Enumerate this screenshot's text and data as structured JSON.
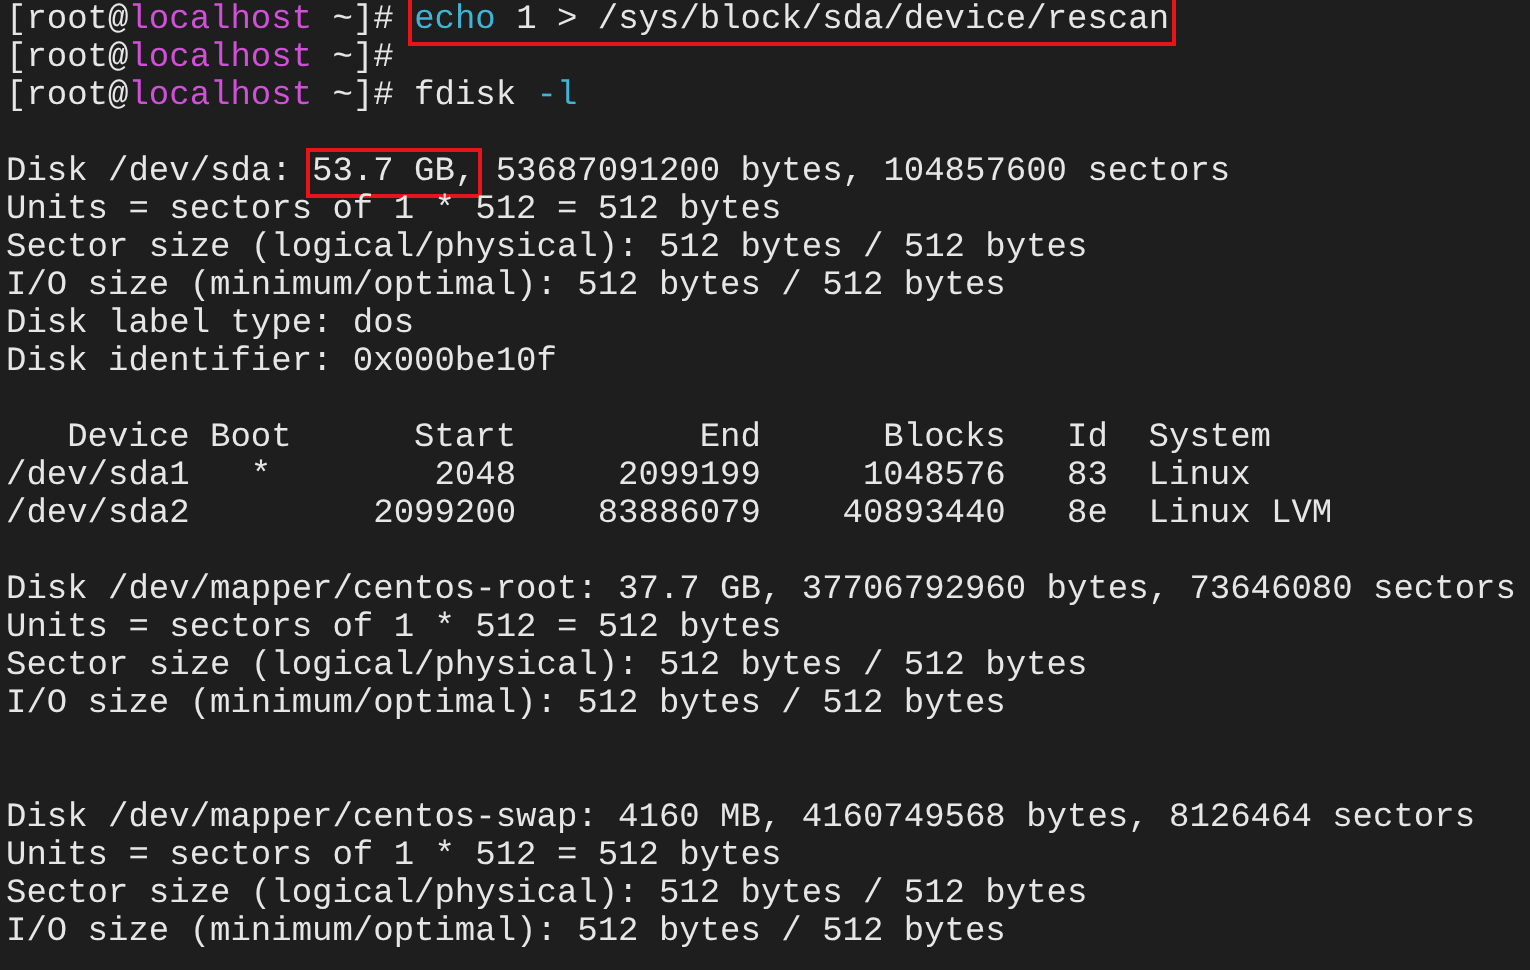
{
  "terminal": {
    "lines": [
      {
        "kind": "text",
        "segments": [
          {
            "text": "[root@",
            "kind": "plain",
            "boxed": false
          },
          {
            "text": "localhost",
            "kind": "host",
            "boxed": false
          },
          {
            "text": " ~]# ",
            "kind": "plain",
            "boxed": false
          },
          {
            "text": "echo",
            "kind": "keyword",
            "boxed": true
          },
          {
            "text": " 1 > /sys/block/sda/device/rescan",
            "kind": "plain",
            "boxed": true
          }
        ]
      },
      {
        "kind": "text",
        "segments": [
          {
            "text": "[root@",
            "kind": "plain",
            "boxed": false
          },
          {
            "text": "localhost",
            "kind": "host",
            "boxed": false
          },
          {
            "text": " ~]#",
            "kind": "plain",
            "boxed": false
          }
        ]
      },
      {
        "kind": "text",
        "segments": [
          {
            "text": "[root@",
            "kind": "plain",
            "boxed": false
          },
          {
            "text": "localhost",
            "kind": "host",
            "boxed": false
          },
          {
            "text": " ~]# fdisk ",
            "kind": "plain",
            "boxed": false
          },
          {
            "text": "-l",
            "kind": "keyword",
            "boxed": false
          }
        ]
      },
      {
        "kind": "blank"
      },
      {
        "kind": "text",
        "segments": [
          {
            "text": "Disk /dev/sda: ",
            "kind": "plain",
            "boxed": false
          },
          {
            "text": "53.7 GB,",
            "kind": "plain",
            "boxed": true
          },
          {
            "text": " 53687091200 bytes, 104857600 sectors",
            "kind": "plain",
            "boxed": false
          }
        ]
      },
      {
        "kind": "text",
        "segments": [
          {
            "text": "Units = sectors of 1 * 512 = 512 bytes",
            "kind": "plain",
            "boxed": false
          }
        ]
      },
      {
        "kind": "text",
        "segments": [
          {
            "text": "Sector size (logical/physical): 512 bytes / 512 bytes",
            "kind": "plain",
            "boxed": false
          }
        ]
      },
      {
        "kind": "text",
        "segments": [
          {
            "text": "I/O size (minimum/optimal): 512 bytes / 512 bytes",
            "kind": "plain",
            "boxed": false
          }
        ]
      },
      {
        "kind": "text",
        "segments": [
          {
            "text": "Disk label type: dos",
            "kind": "plain",
            "boxed": false
          }
        ]
      },
      {
        "kind": "text",
        "segments": [
          {
            "text": "Disk identifier: 0x000be10f",
            "kind": "plain",
            "boxed": false
          }
        ]
      },
      {
        "kind": "blank"
      },
      {
        "kind": "text",
        "segments": [
          {
            "text": "   Device Boot      Start         End      Blocks   Id  System",
            "kind": "plain",
            "boxed": false
          }
        ]
      },
      {
        "kind": "text",
        "segments": [
          {
            "text": "/dev/sda1   *        2048     2099199     1048576   83  Linux",
            "kind": "plain",
            "boxed": false
          }
        ]
      },
      {
        "kind": "text",
        "segments": [
          {
            "text": "/dev/sda2         2099200    83886079    40893440   8e  Linux LVM",
            "kind": "plain",
            "boxed": false
          }
        ]
      },
      {
        "kind": "blank"
      },
      {
        "kind": "text",
        "segments": [
          {
            "text": "Disk /dev/mapper/centos-root: 37.7 GB, 37706792960 bytes, 73646080 sectors",
            "kind": "plain",
            "boxed": false
          }
        ]
      },
      {
        "kind": "text",
        "segments": [
          {
            "text": "Units = sectors of 1 * 512 = 512 bytes",
            "kind": "plain",
            "boxed": false
          }
        ]
      },
      {
        "kind": "text",
        "segments": [
          {
            "text": "Sector size (logical/physical): 512 bytes / 512 bytes",
            "kind": "plain",
            "boxed": false
          }
        ]
      },
      {
        "kind": "text",
        "segments": [
          {
            "text": "I/O size (minimum/optimal): 512 bytes / 512 bytes",
            "kind": "plain",
            "boxed": false
          }
        ]
      },
      {
        "kind": "blank"
      },
      {
        "kind": "blank"
      },
      {
        "kind": "text",
        "segments": [
          {
            "text": "Disk /dev/mapper/centos-swap: 4160 MB, 4160749568 bytes, 8126464 sectors",
            "kind": "plain",
            "boxed": false
          }
        ]
      },
      {
        "kind": "text",
        "segments": [
          {
            "text": "Units = sectors of 1 * 512 = 512 bytes",
            "kind": "plain",
            "boxed": false
          }
        ]
      },
      {
        "kind": "text",
        "segments": [
          {
            "text": "Sector size (logical/physical): 512 bytes / 512 bytes",
            "kind": "plain",
            "boxed": false
          }
        ]
      },
      {
        "kind": "text",
        "segments": [
          {
            "text": "I/O size (minimum/optimal): 512 bytes / 512 bytes",
            "kind": "plain",
            "boxed": false
          }
        ]
      }
    ]
  }
}
